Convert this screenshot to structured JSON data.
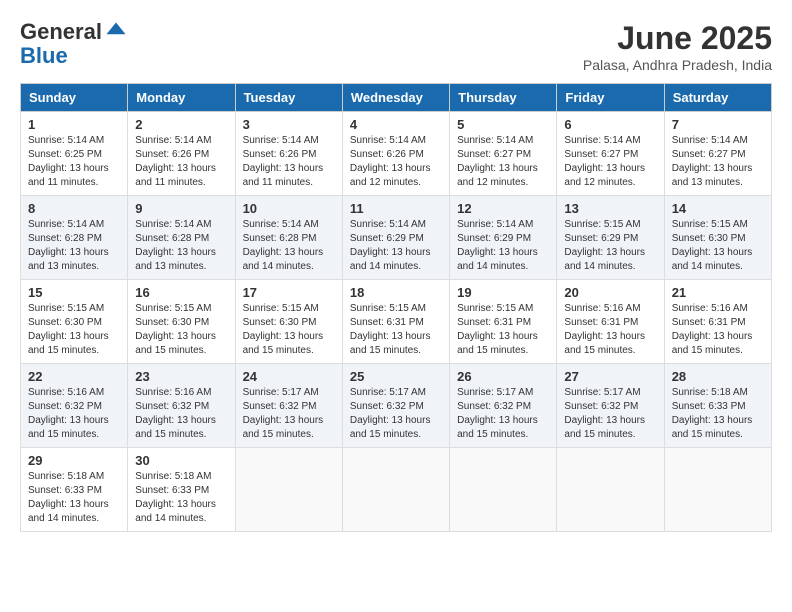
{
  "logo": {
    "general": "General",
    "blue": "Blue"
  },
  "title": "June 2025",
  "subtitle": "Palasa, Andhra Pradesh, India",
  "header_days": [
    "Sunday",
    "Monday",
    "Tuesday",
    "Wednesday",
    "Thursday",
    "Friday",
    "Saturday"
  ],
  "weeks": [
    [
      {
        "day": "1",
        "sunrise": "5:14 AM",
        "sunset": "6:25 PM",
        "daylight": "13 hours and 11 minutes."
      },
      {
        "day": "2",
        "sunrise": "5:14 AM",
        "sunset": "6:26 PM",
        "daylight": "13 hours and 11 minutes."
      },
      {
        "day": "3",
        "sunrise": "5:14 AM",
        "sunset": "6:26 PM",
        "daylight": "13 hours and 11 minutes."
      },
      {
        "day": "4",
        "sunrise": "5:14 AM",
        "sunset": "6:26 PM",
        "daylight": "13 hours and 12 minutes."
      },
      {
        "day": "5",
        "sunrise": "5:14 AM",
        "sunset": "6:27 PM",
        "daylight": "13 hours and 12 minutes."
      },
      {
        "day": "6",
        "sunrise": "5:14 AM",
        "sunset": "6:27 PM",
        "daylight": "13 hours and 12 minutes."
      },
      {
        "day": "7",
        "sunrise": "5:14 AM",
        "sunset": "6:27 PM",
        "daylight": "13 hours and 13 minutes."
      }
    ],
    [
      {
        "day": "8",
        "sunrise": "5:14 AM",
        "sunset": "6:28 PM",
        "daylight": "13 hours and 13 minutes."
      },
      {
        "day": "9",
        "sunrise": "5:14 AM",
        "sunset": "6:28 PM",
        "daylight": "13 hours and 13 minutes."
      },
      {
        "day": "10",
        "sunrise": "5:14 AM",
        "sunset": "6:28 PM",
        "daylight": "13 hours and 14 minutes."
      },
      {
        "day": "11",
        "sunrise": "5:14 AM",
        "sunset": "6:29 PM",
        "daylight": "13 hours and 14 minutes."
      },
      {
        "day": "12",
        "sunrise": "5:14 AM",
        "sunset": "6:29 PM",
        "daylight": "13 hours and 14 minutes."
      },
      {
        "day": "13",
        "sunrise": "5:15 AM",
        "sunset": "6:29 PM",
        "daylight": "13 hours and 14 minutes."
      },
      {
        "day": "14",
        "sunrise": "5:15 AM",
        "sunset": "6:30 PM",
        "daylight": "13 hours and 14 minutes."
      }
    ],
    [
      {
        "day": "15",
        "sunrise": "5:15 AM",
        "sunset": "6:30 PM",
        "daylight": "13 hours and 15 minutes."
      },
      {
        "day": "16",
        "sunrise": "5:15 AM",
        "sunset": "6:30 PM",
        "daylight": "13 hours and 15 minutes."
      },
      {
        "day": "17",
        "sunrise": "5:15 AM",
        "sunset": "6:30 PM",
        "daylight": "13 hours and 15 minutes."
      },
      {
        "day": "18",
        "sunrise": "5:15 AM",
        "sunset": "6:31 PM",
        "daylight": "13 hours and 15 minutes."
      },
      {
        "day": "19",
        "sunrise": "5:15 AM",
        "sunset": "6:31 PM",
        "daylight": "13 hours and 15 minutes."
      },
      {
        "day": "20",
        "sunrise": "5:16 AM",
        "sunset": "6:31 PM",
        "daylight": "13 hours and 15 minutes."
      },
      {
        "day": "21",
        "sunrise": "5:16 AM",
        "sunset": "6:31 PM",
        "daylight": "13 hours and 15 minutes."
      }
    ],
    [
      {
        "day": "22",
        "sunrise": "5:16 AM",
        "sunset": "6:32 PM",
        "daylight": "13 hours and 15 minutes."
      },
      {
        "day": "23",
        "sunrise": "5:16 AM",
        "sunset": "6:32 PM",
        "daylight": "13 hours and 15 minutes."
      },
      {
        "day": "24",
        "sunrise": "5:17 AM",
        "sunset": "6:32 PM",
        "daylight": "13 hours and 15 minutes."
      },
      {
        "day": "25",
        "sunrise": "5:17 AM",
        "sunset": "6:32 PM",
        "daylight": "13 hours and 15 minutes."
      },
      {
        "day": "26",
        "sunrise": "5:17 AM",
        "sunset": "6:32 PM",
        "daylight": "13 hours and 15 minutes."
      },
      {
        "day": "27",
        "sunrise": "5:17 AM",
        "sunset": "6:32 PM",
        "daylight": "13 hours and 15 minutes."
      },
      {
        "day": "28",
        "sunrise": "5:18 AM",
        "sunset": "6:33 PM",
        "daylight": "13 hours and 15 minutes."
      }
    ],
    [
      {
        "day": "29",
        "sunrise": "5:18 AM",
        "sunset": "6:33 PM",
        "daylight": "13 hours and 14 minutes."
      },
      {
        "day": "30",
        "sunrise": "5:18 AM",
        "sunset": "6:33 PM",
        "daylight": "13 hours and 14 minutes."
      },
      null,
      null,
      null,
      null,
      null
    ]
  ]
}
